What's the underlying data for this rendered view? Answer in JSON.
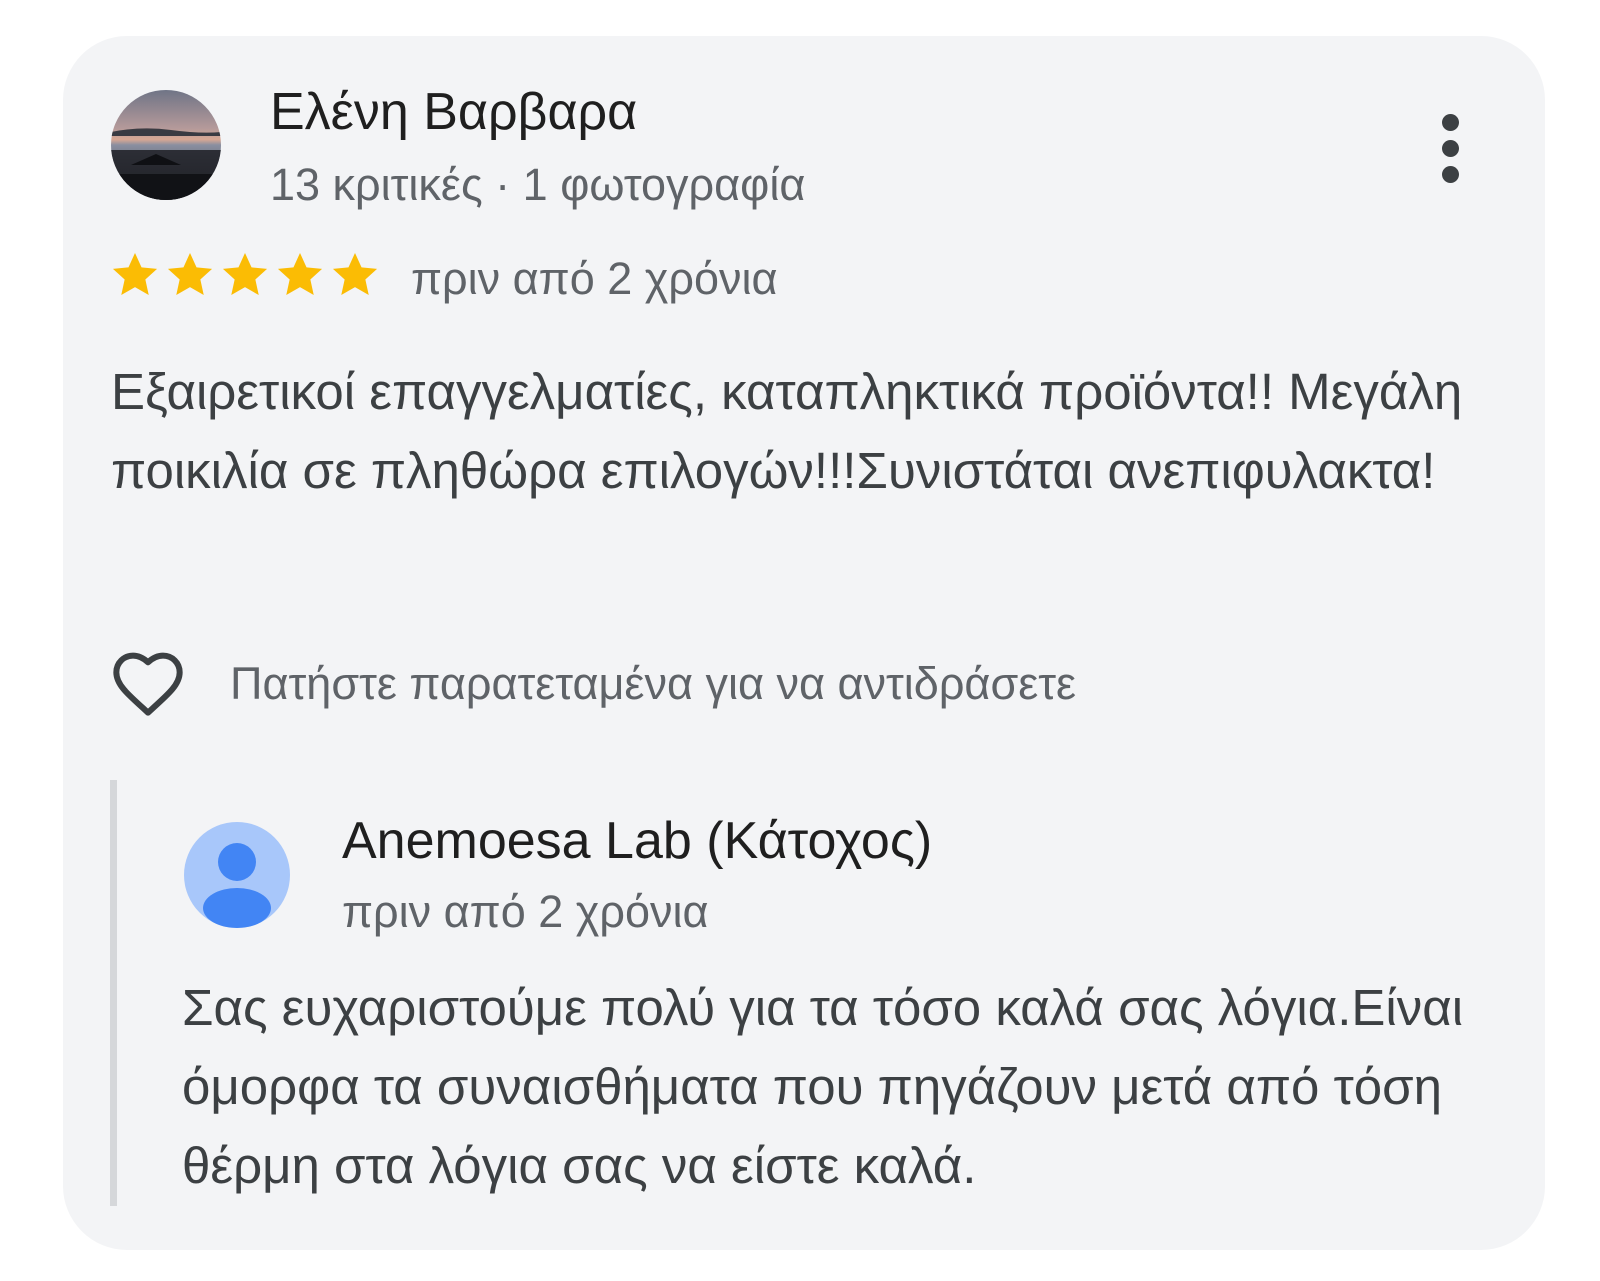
{
  "review": {
    "reviewer_name": "Ελένη Βαρβαρα",
    "reviewer_meta": "13 κριτικές · 1 φωτογραφία",
    "rating": 5,
    "rating_max": 5,
    "time": "πριν από 2 χρόνια",
    "text": "Εξαιρετικοί επαγγελματίες, καταπληκτικά προϊόντα!! Μεγάλη ποικιλία σε πληθώρα επιλογών!!!Συνιστάται ανεπιφυλακτα!",
    "react_hint": "Πατήστε παρατεταμένα για να αντιδράσετε"
  },
  "reply": {
    "owner_name": "Anemoesa Lab (Κάτοχος)",
    "time": "πριν από 2 χρόνια",
    "text": "Σας ευχαριστούμε πολύ για τα τόσο καλά σας λόγια.Είναι όμορφα τα συναισθήματα που πηγάζουν μετά από τόση θέρμη στα λόγια σας να είστε καλά."
  },
  "icons": {
    "more": "more-vert-icon",
    "star": "star-icon",
    "heart": "heart-outline-icon",
    "owner_avatar": "person-icon"
  },
  "colors": {
    "card_background": "#f3f4f6",
    "star": "#fbbc04",
    "primary_text": "#1f1f1f",
    "secondary_text": "#5f6368",
    "body_text": "#3c4043",
    "reply_bar": "#d5d7da",
    "owner_avatar_bg": "#a8c7fa",
    "owner_avatar_fg": "#4285f4"
  }
}
